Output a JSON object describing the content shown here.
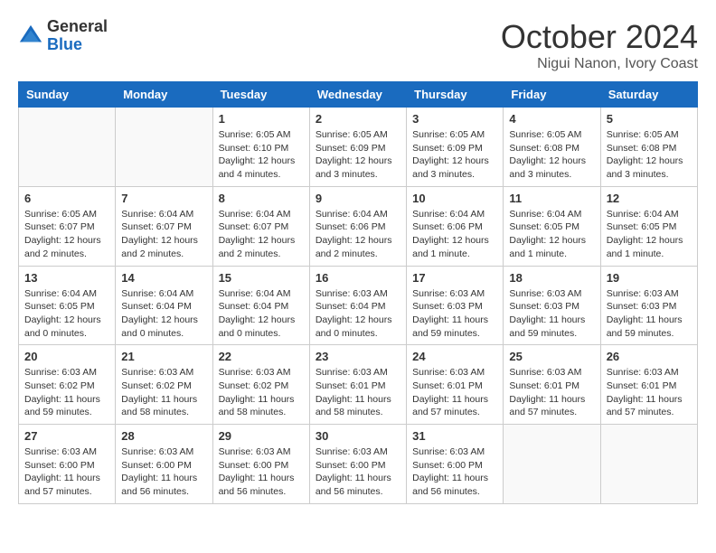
{
  "logo": {
    "general": "General",
    "blue": "Blue"
  },
  "title": {
    "month": "October 2024",
    "location": "Nigui Nanon, Ivory Coast"
  },
  "weekdays": [
    "Sunday",
    "Monday",
    "Tuesday",
    "Wednesday",
    "Thursday",
    "Friday",
    "Saturday"
  ],
  "weeks": [
    [
      {
        "day": "",
        "info": ""
      },
      {
        "day": "",
        "info": ""
      },
      {
        "day": "1",
        "info": "Sunrise: 6:05 AM\nSunset: 6:10 PM\nDaylight: 12 hours and 4 minutes."
      },
      {
        "day": "2",
        "info": "Sunrise: 6:05 AM\nSunset: 6:09 PM\nDaylight: 12 hours and 3 minutes."
      },
      {
        "day": "3",
        "info": "Sunrise: 6:05 AM\nSunset: 6:09 PM\nDaylight: 12 hours and 3 minutes."
      },
      {
        "day": "4",
        "info": "Sunrise: 6:05 AM\nSunset: 6:08 PM\nDaylight: 12 hours and 3 minutes."
      },
      {
        "day": "5",
        "info": "Sunrise: 6:05 AM\nSunset: 6:08 PM\nDaylight: 12 hours and 3 minutes."
      }
    ],
    [
      {
        "day": "6",
        "info": "Sunrise: 6:05 AM\nSunset: 6:07 PM\nDaylight: 12 hours and 2 minutes."
      },
      {
        "day": "7",
        "info": "Sunrise: 6:04 AM\nSunset: 6:07 PM\nDaylight: 12 hours and 2 minutes."
      },
      {
        "day": "8",
        "info": "Sunrise: 6:04 AM\nSunset: 6:07 PM\nDaylight: 12 hours and 2 minutes."
      },
      {
        "day": "9",
        "info": "Sunrise: 6:04 AM\nSunset: 6:06 PM\nDaylight: 12 hours and 2 minutes."
      },
      {
        "day": "10",
        "info": "Sunrise: 6:04 AM\nSunset: 6:06 PM\nDaylight: 12 hours and 1 minute."
      },
      {
        "day": "11",
        "info": "Sunrise: 6:04 AM\nSunset: 6:05 PM\nDaylight: 12 hours and 1 minute."
      },
      {
        "day": "12",
        "info": "Sunrise: 6:04 AM\nSunset: 6:05 PM\nDaylight: 12 hours and 1 minute."
      }
    ],
    [
      {
        "day": "13",
        "info": "Sunrise: 6:04 AM\nSunset: 6:05 PM\nDaylight: 12 hours and 0 minutes."
      },
      {
        "day": "14",
        "info": "Sunrise: 6:04 AM\nSunset: 6:04 PM\nDaylight: 12 hours and 0 minutes."
      },
      {
        "day": "15",
        "info": "Sunrise: 6:04 AM\nSunset: 6:04 PM\nDaylight: 12 hours and 0 minutes."
      },
      {
        "day": "16",
        "info": "Sunrise: 6:03 AM\nSunset: 6:04 PM\nDaylight: 12 hours and 0 minutes."
      },
      {
        "day": "17",
        "info": "Sunrise: 6:03 AM\nSunset: 6:03 PM\nDaylight: 11 hours and 59 minutes."
      },
      {
        "day": "18",
        "info": "Sunrise: 6:03 AM\nSunset: 6:03 PM\nDaylight: 11 hours and 59 minutes."
      },
      {
        "day": "19",
        "info": "Sunrise: 6:03 AM\nSunset: 6:03 PM\nDaylight: 11 hours and 59 minutes."
      }
    ],
    [
      {
        "day": "20",
        "info": "Sunrise: 6:03 AM\nSunset: 6:02 PM\nDaylight: 11 hours and 59 minutes."
      },
      {
        "day": "21",
        "info": "Sunrise: 6:03 AM\nSunset: 6:02 PM\nDaylight: 11 hours and 58 minutes."
      },
      {
        "day": "22",
        "info": "Sunrise: 6:03 AM\nSunset: 6:02 PM\nDaylight: 11 hours and 58 minutes."
      },
      {
        "day": "23",
        "info": "Sunrise: 6:03 AM\nSunset: 6:01 PM\nDaylight: 11 hours and 58 minutes."
      },
      {
        "day": "24",
        "info": "Sunrise: 6:03 AM\nSunset: 6:01 PM\nDaylight: 11 hours and 57 minutes."
      },
      {
        "day": "25",
        "info": "Sunrise: 6:03 AM\nSunset: 6:01 PM\nDaylight: 11 hours and 57 minutes."
      },
      {
        "day": "26",
        "info": "Sunrise: 6:03 AM\nSunset: 6:01 PM\nDaylight: 11 hours and 57 minutes."
      }
    ],
    [
      {
        "day": "27",
        "info": "Sunrise: 6:03 AM\nSunset: 6:00 PM\nDaylight: 11 hours and 57 minutes."
      },
      {
        "day": "28",
        "info": "Sunrise: 6:03 AM\nSunset: 6:00 PM\nDaylight: 11 hours and 56 minutes."
      },
      {
        "day": "29",
        "info": "Sunrise: 6:03 AM\nSunset: 6:00 PM\nDaylight: 11 hours and 56 minutes."
      },
      {
        "day": "30",
        "info": "Sunrise: 6:03 AM\nSunset: 6:00 PM\nDaylight: 11 hours and 56 minutes."
      },
      {
        "day": "31",
        "info": "Sunrise: 6:03 AM\nSunset: 6:00 PM\nDaylight: 11 hours and 56 minutes."
      },
      {
        "day": "",
        "info": ""
      },
      {
        "day": "",
        "info": ""
      }
    ]
  ]
}
